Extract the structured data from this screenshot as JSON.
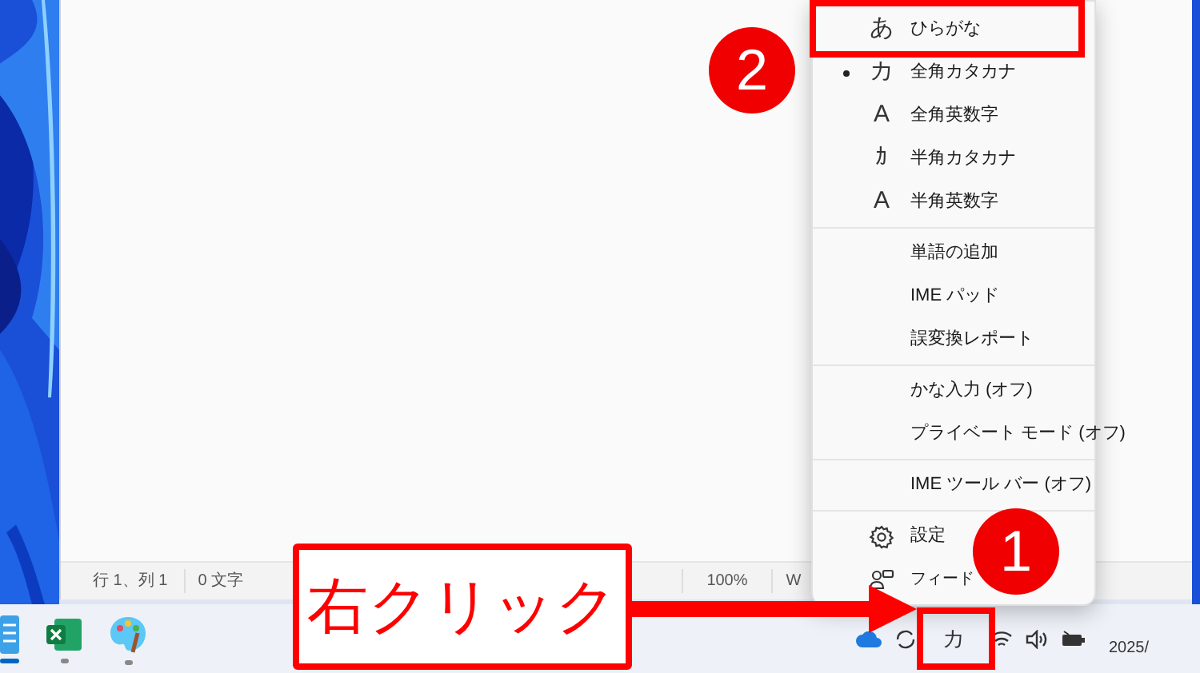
{
  "notepad": {
    "status_bar": [
      "行 1、列 1",
      "0 文字",
      "100%",
      "W"
    ]
  },
  "taskbar": {
    "apps": [
      {
        "kind": "notepad",
        "selected": true
      },
      {
        "kind": "excel",
        "selected": false
      },
      {
        "kind": "paint",
        "selected": false
      }
    ],
    "ime_indicator": "カ",
    "date": "2025/"
  },
  "ime_menu": {
    "items": [
      {
        "kind": "mode",
        "glyph": "あ",
        "label": "ひらがな",
        "selected": false
      },
      {
        "kind": "mode",
        "glyph": "カ",
        "label": "全角カタカナ",
        "selected": true
      },
      {
        "kind": "mode",
        "glyph": "A",
        "label": "全角英数字",
        "selected": false
      },
      {
        "kind": "mode",
        "glyph": "ｶ",
        "label": "半角カタカナ",
        "selected": false
      },
      {
        "kind": "mode",
        "glyph": "A",
        "label": "半角英数字",
        "selected": false
      },
      {
        "kind": "divider"
      },
      {
        "kind": "action",
        "label": "単語の追加"
      },
      {
        "kind": "action",
        "label": "IME パッド"
      },
      {
        "kind": "action",
        "label": "誤変換レポート"
      },
      {
        "kind": "divider"
      },
      {
        "kind": "action",
        "label": "かな入力 (オフ)"
      },
      {
        "kind": "action",
        "label": "プライベート モード (オフ)"
      },
      {
        "kind": "divider"
      },
      {
        "kind": "action",
        "label": "IME ツール バー (オフ)"
      },
      {
        "kind": "divider"
      },
      {
        "kind": "settings",
        "label": "設定"
      },
      {
        "kind": "feedback",
        "label": "フィード"
      }
    ]
  },
  "annotations": {
    "callout": "右クリック",
    "markers": [
      "2",
      "1"
    ]
  }
}
